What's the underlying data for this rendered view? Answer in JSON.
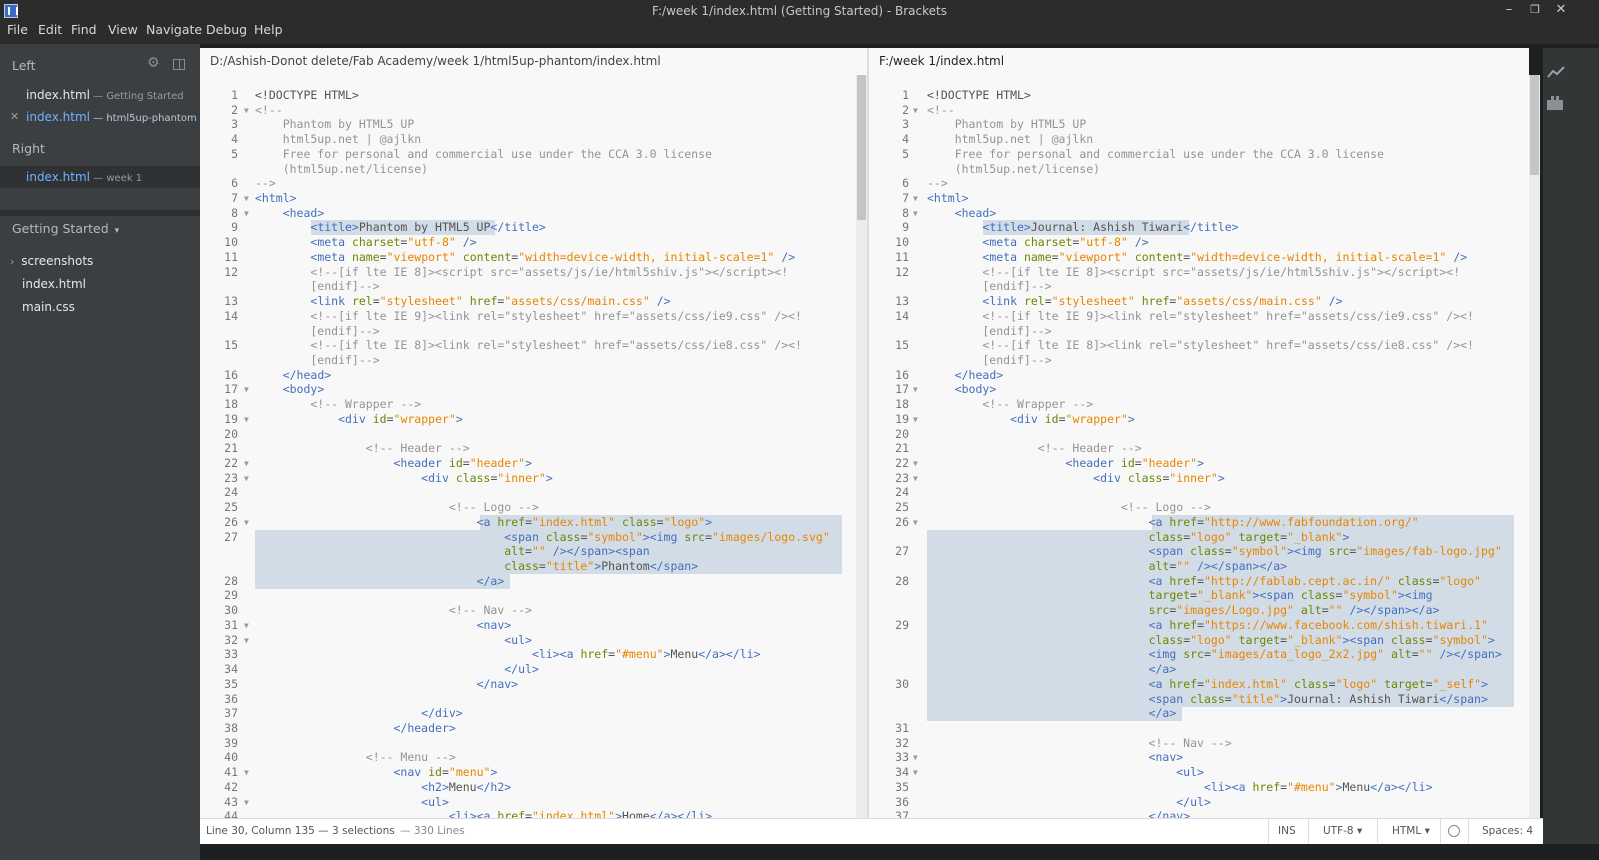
{
  "window": {
    "title": "F:/week 1/index.html (Getting Started) - Brackets",
    "minimize": "–",
    "maximize": "❐",
    "close": "✕"
  },
  "menu": [
    "File",
    "Edit",
    "Find",
    "View",
    "Navigate",
    "Debug",
    "Help"
  ],
  "sidebar": {
    "left_header": "Left",
    "left_files": [
      {
        "name": "index.html",
        "dir": " — Getting Started"
      },
      {
        "name": "index.html",
        "dir": " — html5up-phantom"
      }
    ],
    "close_mark": "✕",
    "right_header": "Right",
    "right_files": [
      {
        "name": "index.html",
        "dir": " — week 1"
      }
    ],
    "project_title": "Getting Started",
    "project_caret": "▾",
    "tree": [
      "screenshots",
      "index.html",
      "main.css"
    ],
    "tree_caret": "›"
  },
  "left_pane": {
    "path": "D:/Ashish-Donot delete/Fab Academy/week 1/html5up-phantom/index.html",
    "lines": [
      {
        "n": "1",
        "html": "&lt;!DOCTYPE HTML&gt;"
      },
      {
        "n": "2",
        "fold": true,
        "html": "<span class='c'>&lt;!--</span>"
      },
      {
        "n": "3",
        "html": "<span class='c'>    Phantom by HTML5 UP</span>"
      },
      {
        "n": "4",
        "html": "<span class='c'>    html5up.net | @ajlkn</span>"
      },
      {
        "n": "5",
        "html": "<span class='c'>    Free for personal and commercial use under the CCA 3.0 license</span>"
      },
      {
        "n": "",
        "html": "<span class='c'>    (html5up.net/license)</span>"
      },
      {
        "n": "6",
        "html": "<span class='c'>--&gt;</span>"
      },
      {
        "n": "7",
        "fold": true,
        "html": "<span class='t'>&lt;html&gt;</span>"
      },
      {
        "n": "8",
        "fold": true,
        "html": "    <span class='t'>&lt;head&gt;</span>"
      },
      {
        "n": "9",
        "html": "        <span class='t'>&lt;title&gt;</span>Phantom by HTML5 UP<span class='t'>&lt;/title&gt;</span>",
        "hl": [
          56,
          240
        ]
      },
      {
        "n": "10",
        "html": "        <span class='t'>&lt;meta</span> <span class='a'>charset</span>=<span class='s'>\"utf-8\"</span> <span class='t'>/&gt;</span>"
      },
      {
        "n": "11",
        "html": "        <span class='t'>&lt;meta</span> <span class='a'>name</span>=<span class='s'>\"viewport\"</span> <span class='a'>content</span>=<span class='s'>\"width=device-width, initial-scale=1\"</span> <span class='t'>/&gt;</span>"
      },
      {
        "n": "12",
        "html": "<span class='c'>        &lt;!--[if lte IE 8]&gt;&lt;script src=\"assets/js/ie/html5shiv.js\"&gt;&lt;/script&gt;&lt;!</span>"
      },
      {
        "n": "",
        "html": "<span class='c'>        [endif]--&gt;</span>"
      },
      {
        "n": "13",
        "html": "        <span class='t'>&lt;link</span> <span class='a'>rel</span>=<span class='s'>\"stylesheet\"</span> <span class='a'>href</span>=<span class='s'>\"assets/css/main.css\"</span> <span class='t'>/&gt;</span>"
      },
      {
        "n": "14",
        "html": "<span class='c'>        &lt;!--[if lte IE 9]&gt;&lt;link rel=\"stylesheet\" href=\"assets/css/ie9.css\" /&gt;&lt;!</span>"
      },
      {
        "n": "",
        "html": "<span class='c'>        [endif]--&gt;</span>"
      },
      {
        "n": "15",
        "html": "<span class='c'>        &lt;!--[if lte IE 8]&gt;&lt;link rel=\"stylesheet\" href=\"assets/css/ie8.css\" /&gt;&lt;!</span>"
      },
      {
        "n": "",
        "html": "<span class='c'>        [endif]--&gt;</span>"
      },
      {
        "n": "16",
        "html": "    <span class='t'>&lt;/head&gt;</span>"
      },
      {
        "n": "17",
        "fold": true,
        "html": "    <span class='t'>&lt;body&gt;</span>"
      },
      {
        "n": "18",
        "html": "<span class='c'>        &lt;!-- Wrapper --&gt;</span>"
      },
      {
        "n": "19",
        "fold": true,
        "html": "            <span class='t'>&lt;div</span> <span class='a'>id</span>=<span class='s'>\"wrapper\"</span><span class='t'>&gt;</span>"
      },
      {
        "n": "20",
        "html": ""
      },
      {
        "n": "21",
        "html": "<span class='c'>                &lt;!-- Header --&gt;</span>"
      },
      {
        "n": "22",
        "fold": true,
        "html": "                    <span class='t'>&lt;header</span> <span class='a'>id</span>=<span class='s'>\"header\"</span><span class='t'>&gt;</span>"
      },
      {
        "n": "23",
        "fold": true,
        "html": "                        <span class='t'>&lt;div</span> <span class='a'>class</span>=<span class='s'>\"inner\"</span><span class='t'>&gt;</span>"
      },
      {
        "n": "24",
        "html": ""
      },
      {
        "n": "25",
        "html": "<span class='c'>                            &lt;!-- Logo --&gt;</span>"
      },
      {
        "n": "26",
        "fold": true,
        "html": "                                <span class='t'>&lt;a</span> <span class='a'>href</span>=<span class='s'>\"index.html\"</span> <span class='a'>class</span>=<span class='s'>\"logo\"</span><span class='t'>&gt;</span>",
        "hl": [
          225,
          587
        ]
      },
      {
        "n": "27",
        "html": "                                    <span class='t'>&lt;span</span> <span class='a'>class</span>=<span class='s'>\"symbol\"</span><span class='t'>&gt;&lt;img</span> <span class='a'>src</span>=<span class='s'>\"images/logo.svg\"</span>",
        "hl": [
          0,
          587
        ]
      },
      {
        "n": "",
        "html": "                                    <span class='a'>alt</span>=<span class='s'>\"\"</span> <span class='t'>/&gt;&lt;/span&gt;&lt;span</span>",
        "hl": [
          0,
          587
        ]
      },
      {
        "n": "",
        "html": "                                    <span class='a'>class</span>=<span class='s'>\"title\"</span><span class='t'>&gt;</span>Phantom<span class='t'>&lt;/span&gt;</span>",
        "hl": [
          0,
          587
        ]
      },
      {
        "n": "28",
        "html": "                                <span class='t'>&lt;/a&gt;</span>",
        "hl": [
          0,
          255
        ]
      },
      {
        "n": "29",
        "html": ""
      },
      {
        "n": "30",
        "html": "<span class='c'>                            &lt;!-- Nav --&gt;</span>"
      },
      {
        "n": "31",
        "fold": true,
        "html": "                                <span class='t'>&lt;nav&gt;</span>"
      },
      {
        "n": "32",
        "fold": true,
        "html": "                                    <span class='t'>&lt;ul&gt;</span>"
      },
      {
        "n": "33",
        "html": "                                        <span class='t'>&lt;li&gt;&lt;a</span> <span class='a'>href</span>=<span class='s'>\"#menu\"</span><span class='t'>&gt;</span>Menu<span class='t'>&lt;/a&gt;&lt;/li&gt;</span>"
      },
      {
        "n": "34",
        "html": "                                    <span class='t'>&lt;/ul&gt;</span>"
      },
      {
        "n": "35",
        "html": "                                <span class='t'>&lt;/nav&gt;</span>"
      },
      {
        "n": "36",
        "html": ""
      },
      {
        "n": "37",
        "html": "                        <span class='t'>&lt;/div&gt;</span>"
      },
      {
        "n": "38",
        "html": "                    <span class='t'>&lt;/header&gt;</span>"
      },
      {
        "n": "39",
        "html": ""
      },
      {
        "n": "40",
        "html": "<span class='c'>                &lt;!-- Menu --&gt;</span>"
      },
      {
        "n": "41",
        "fold": true,
        "html": "                    <span class='t'>&lt;nav</span> <span class='a'>id</span>=<span class='s'>\"menu\"</span><span class='t'>&gt;</span>"
      },
      {
        "n": "42",
        "html": "                        <span class='t'>&lt;h2&gt;</span>Menu<span class='t'>&lt;/h2&gt;</span>"
      },
      {
        "n": "43",
        "fold": true,
        "html": "                        <span class='t'>&lt;ul&gt;</span>"
      },
      {
        "n": "44",
        "html": "                            <span class='t'>&lt;li&gt;&lt;a</span> <span class='a'>href</span>=<span class='s'>\"index.html\"</span><span class='t'>&gt;</span>Home<span class='t'>&lt;/a&gt;&lt;/li&gt;</span>"
      }
    ]
  },
  "right_pane": {
    "path": "F:/week 1/index.html",
    "lines": [
      {
        "n": "1",
        "html": "&lt;!DOCTYPE HTML&gt;"
      },
      {
        "n": "2",
        "fold": true,
        "html": "<span class='c'>&lt;!--</span>"
      },
      {
        "n": "3",
        "html": "<span class='c'>    Phantom by HTML5 UP</span>"
      },
      {
        "n": "4",
        "html": "<span class='c'>    html5up.net | @ajlkn</span>"
      },
      {
        "n": "5",
        "html": "<span class='c'>    Free for personal and commercial use under the CCA 3.0 license</span>"
      },
      {
        "n": "",
        "html": "<span class='c'>    (html5up.net/license)</span>"
      },
      {
        "n": "6",
        "html": "<span class='c'>--&gt;</span>"
      },
      {
        "n": "7",
        "fold": true,
        "html": "<span class='t'>&lt;html&gt;</span>"
      },
      {
        "n": "8",
        "fold": true,
        "html": "    <span class='t'>&lt;head&gt;</span>"
      },
      {
        "n": "9",
        "html": "        <span class='t'>&lt;title&gt;</span>Journal: Ashish Tiwari<span class='t'>&lt;/title&gt;</span>",
        "hl": [
          56,
          262
        ]
      },
      {
        "n": "10",
        "html": "        <span class='t'>&lt;meta</span> <span class='a'>charset</span>=<span class='s'>\"utf-8\"</span> <span class='t'>/&gt;</span>"
      },
      {
        "n": "11",
        "html": "        <span class='t'>&lt;meta</span> <span class='a'>name</span>=<span class='s'>\"viewport\"</span> <span class='a'>content</span>=<span class='s'>\"width=device-width, initial-scale=1\"</span> <span class='t'>/&gt;</span>"
      },
      {
        "n": "12",
        "html": "<span class='c'>        &lt;!--[if lte IE 8]&gt;&lt;script src=\"assets/js/ie/html5shiv.js\"&gt;&lt;/script&gt;&lt;!</span>"
      },
      {
        "n": "",
        "html": "<span class='c'>        [endif]--&gt;</span>"
      },
      {
        "n": "13",
        "html": "        <span class='t'>&lt;link</span> <span class='a'>rel</span>=<span class='s'>\"stylesheet\"</span> <span class='a'>href</span>=<span class='s'>\"assets/css/main.css\"</span> <span class='t'>/&gt;</span>"
      },
      {
        "n": "14",
        "html": "<span class='c'>        &lt;!--[if lte IE 9]&gt;&lt;link rel=\"stylesheet\" href=\"assets/css/ie9.css\" /&gt;&lt;!</span>"
      },
      {
        "n": "",
        "html": "<span class='c'>        [endif]--&gt;</span>"
      },
      {
        "n": "15",
        "html": "<span class='c'>        &lt;!--[if lte IE 8]&gt;&lt;link rel=\"stylesheet\" href=\"assets/css/ie8.css\" /&gt;&lt;!</span>"
      },
      {
        "n": "",
        "html": "<span class='c'>        [endif]--&gt;</span>"
      },
      {
        "n": "16",
        "html": "    <span class='t'>&lt;/head&gt;</span>"
      },
      {
        "n": "17",
        "fold": true,
        "html": "    <span class='t'>&lt;body&gt;</span>"
      },
      {
        "n": "18",
        "html": "<span class='c'>        &lt;!-- Wrapper --&gt;</span>"
      },
      {
        "n": "19",
        "fold": true,
        "html": "            <span class='t'>&lt;div</span> <span class='a'>id</span>=<span class='s'>\"wrapper\"</span><span class='t'>&gt;</span>"
      },
      {
        "n": "20",
        "html": ""
      },
      {
        "n": "21",
        "html": "<span class='c'>                &lt;!-- Header --&gt;</span>"
      },
      {
        "n": "22",
        "fold": true,
        "html": "                    <span class='t'>&lt;header</span> <span class='a'>id</span>=<span class='s'>\"header\"</span><span class='t'>&gt;</span>"
      },
      {
        "n": "23",
        "fold": true,
        "html": "                        <span class='t'>&lt;div</span> <span class='a'>class</span>=<span class='s'>\"inner\"</span><span class='t'>&gt;</span>"
      },
      {
        "n": "24",
        "html": ""
      },
      {
        "n": "25",
        "html": "<span class='c'>                            &lt;!-- Logo --&gt;</span>"
      },
      {
        "n": "26",
        "fold": true,
        "html": "                                <span class='t'>&lt;a</span> <span class='a'>href</span>=<span class='s'>\"http://www.fabfoundation.org/\"</span>",
        "hl": [
          225,
          587
        ]
      },
      {
        "n": "",
        "html": "                                <span class='a'>class</span>=<span class='s'>\"logo\"</span> <span class='a'>target</span>=<span class='s'>\"_blank\"</span><span class='t'>&gt;</span>",
        "hl": [
          0,
          587
        ]
      },
      {
        "n": "27",
        "html": "                                <span class='t'>&lt;span</span> <span class='a'>class</span>=<span class='s'>\"symbol\"</span><span class='t'>&gt;&lt;img</span> <span class='a'>src</span>=<span class='s'>\"images/fab-logo.jpg\"</span>",
        "hl": [
          0,
          587
        ]
      },
      {
        "n": "",
        "html": "                                <span class='a'>alt</span>=<span class='s'>\"\"</span> <span class='t'>/&gt;&lt;/span&gt;&lt;/a&gt;</span>",
        "hl": [
          0,
          587
        ]
      },
      {
        "n": "28",
        "html": "                                <span class='t'>&lt;a</span> <span class='a'>href</span>=<span class='s'>\"http://fablab.cept.ac.in/\"</span> <span class='a'>class</span>=<span class='s'>\"logo\"</span>",
        "hl": [
          0,
          587
        ]
      },
      {
        "n": "",
        "html": "                                <span class='a'>target</span>=<span class='s'>\"_blank\"</span><span class='t'>&gt;&lt;span</span> <span class='a'>class</span>=<span class='s'>\"symbol\"</span><span class='t'>&gt;&lt;img</span>",
        "hl": [
          0,
          587
        ]
      },
      {
        "n": "",
        "html": "                                <span class='a'>src</span>=<span class='s'>\"images/Logo.jpg\"</span> <span class='a'>alt</span>=<span class='s'>\"\"</span> <span class='t'>/&gt;&lt;/span&gt;&lt;/a&gt;</span>",
        "hl": [
          0,
          587
        ]
      },
      {
        "n": "29",
        "html": "                                <span class='t'>&lt;a</span> <span class='a'>href</span>=<span class='s'>\"https://www.facebook.com/shish.tiwari.1\"</span>",
        "hl": [
          0,
          587
        ]
      },
      {
        "n": "",
        "html": "                                <span class='a'>class</span>=<span class='s'>\"logo\"</span> <span class='a'>target</span>=<span class='s'>\"_blank\"</span><span class='t'>&gt;&lt;span</span> <span class='a'>class</span>=<span class='s'>\"symbol\"</span><span class='t'>&gt;</span>",
        "hl": [
          0,
          587
        ]
      },
      {
        "n": "",
        "html": "                                <span class='t'>&lt;img</span> <span class='a'>src</span>=<span class='s'>\"images/ata_logo_2x2.jpg\"</span> <span class='a'>alt</span>=<span class='s'>\"\"</span> <span class='t'>/&gt;&lt;/span&gt;</span>",
        "hl": [
          0,
          587
        ]
      },
      {
        "n": "",
        "html": "                                <span class='t'>&lt;/a&gt;</span>",
        "hl": [
          0,
          587
        ]
      },
      {
        "n": "30",
        "html": "                                <span class='t'>&lt;a</span> <span class='a'>href</span>=<span class='s'>\"index.html\"</span> <span class='a'>class</span>=<span class='s'>\"logo\"</span> <span class='a'>target</span>=<span class='s'>\"_self\"</span><span class='t'>&gt;</span>",
        "hl": [
          0,
          587
        ]
      },
      {
        "n": "",
        "html": "                                <span class='t'>&lt;span</span> <span class='a'>class</span>=<span class='s'>\"title\"</span><span class='t'>&gt;</span>Journal: Ashish Tiwari<span class='t'>&lt;/span&gt;</span>",
        "hl": [
          0,
          587
        ]
      },
      {
        "n": "",
        "html": "                                <span class='t'>&lt;/a&gt;</span>",
        "hl": [
          0,
          255
        ]
      },
      {
        "n": "31",
        "html": ""
      },
      {
        "n": "32",
        "html": "<span class='c'>                                &lt;!-- Nav --&gt;</span>"
      },
      {
        "n": "33",
        "fold": true,
        "html": "                                <span class='t'>&lt;nav&gt;</span>"
      },
      {
        "n": "34",
        "fold": true,
        "html": "                                    <span class='t'>&lt;ul&gt;</span>"
      },
      {
        "n": "35",
        "html": "                                        <span class='t'>&lt;li&gt;&lt;a</span> <span class='a'>href</span>=<span class='s'>\"#menu\"</span><span class='t'>&gt;</span>Menu<span class='t'>&lt;/a&gt;&lt;/li&gt;</span>"
      },
      {
        "n": "36",
        "html": "                                    <span class='t'>&lt;/ul&gt;</span>"
      },
      {
        "n": "37",
        "html": "                                <span class='t'>&lt;/nav&gt;</span>"
      }
    ]
  },
  "status": {
    "cursor": "Line 30, Column 135 — 3 selections",
    "lines": " — 330 Lines",
    "mode": "INS",
    "encoding": "UTF-8",
    "language": "HTML",
    "caret": "▾",
    "spaces": "Spaces: 4"
  },
  "toolbar_icons": [
    "live-preview-icon",
    "extension-manager-icon"
  ]
}
